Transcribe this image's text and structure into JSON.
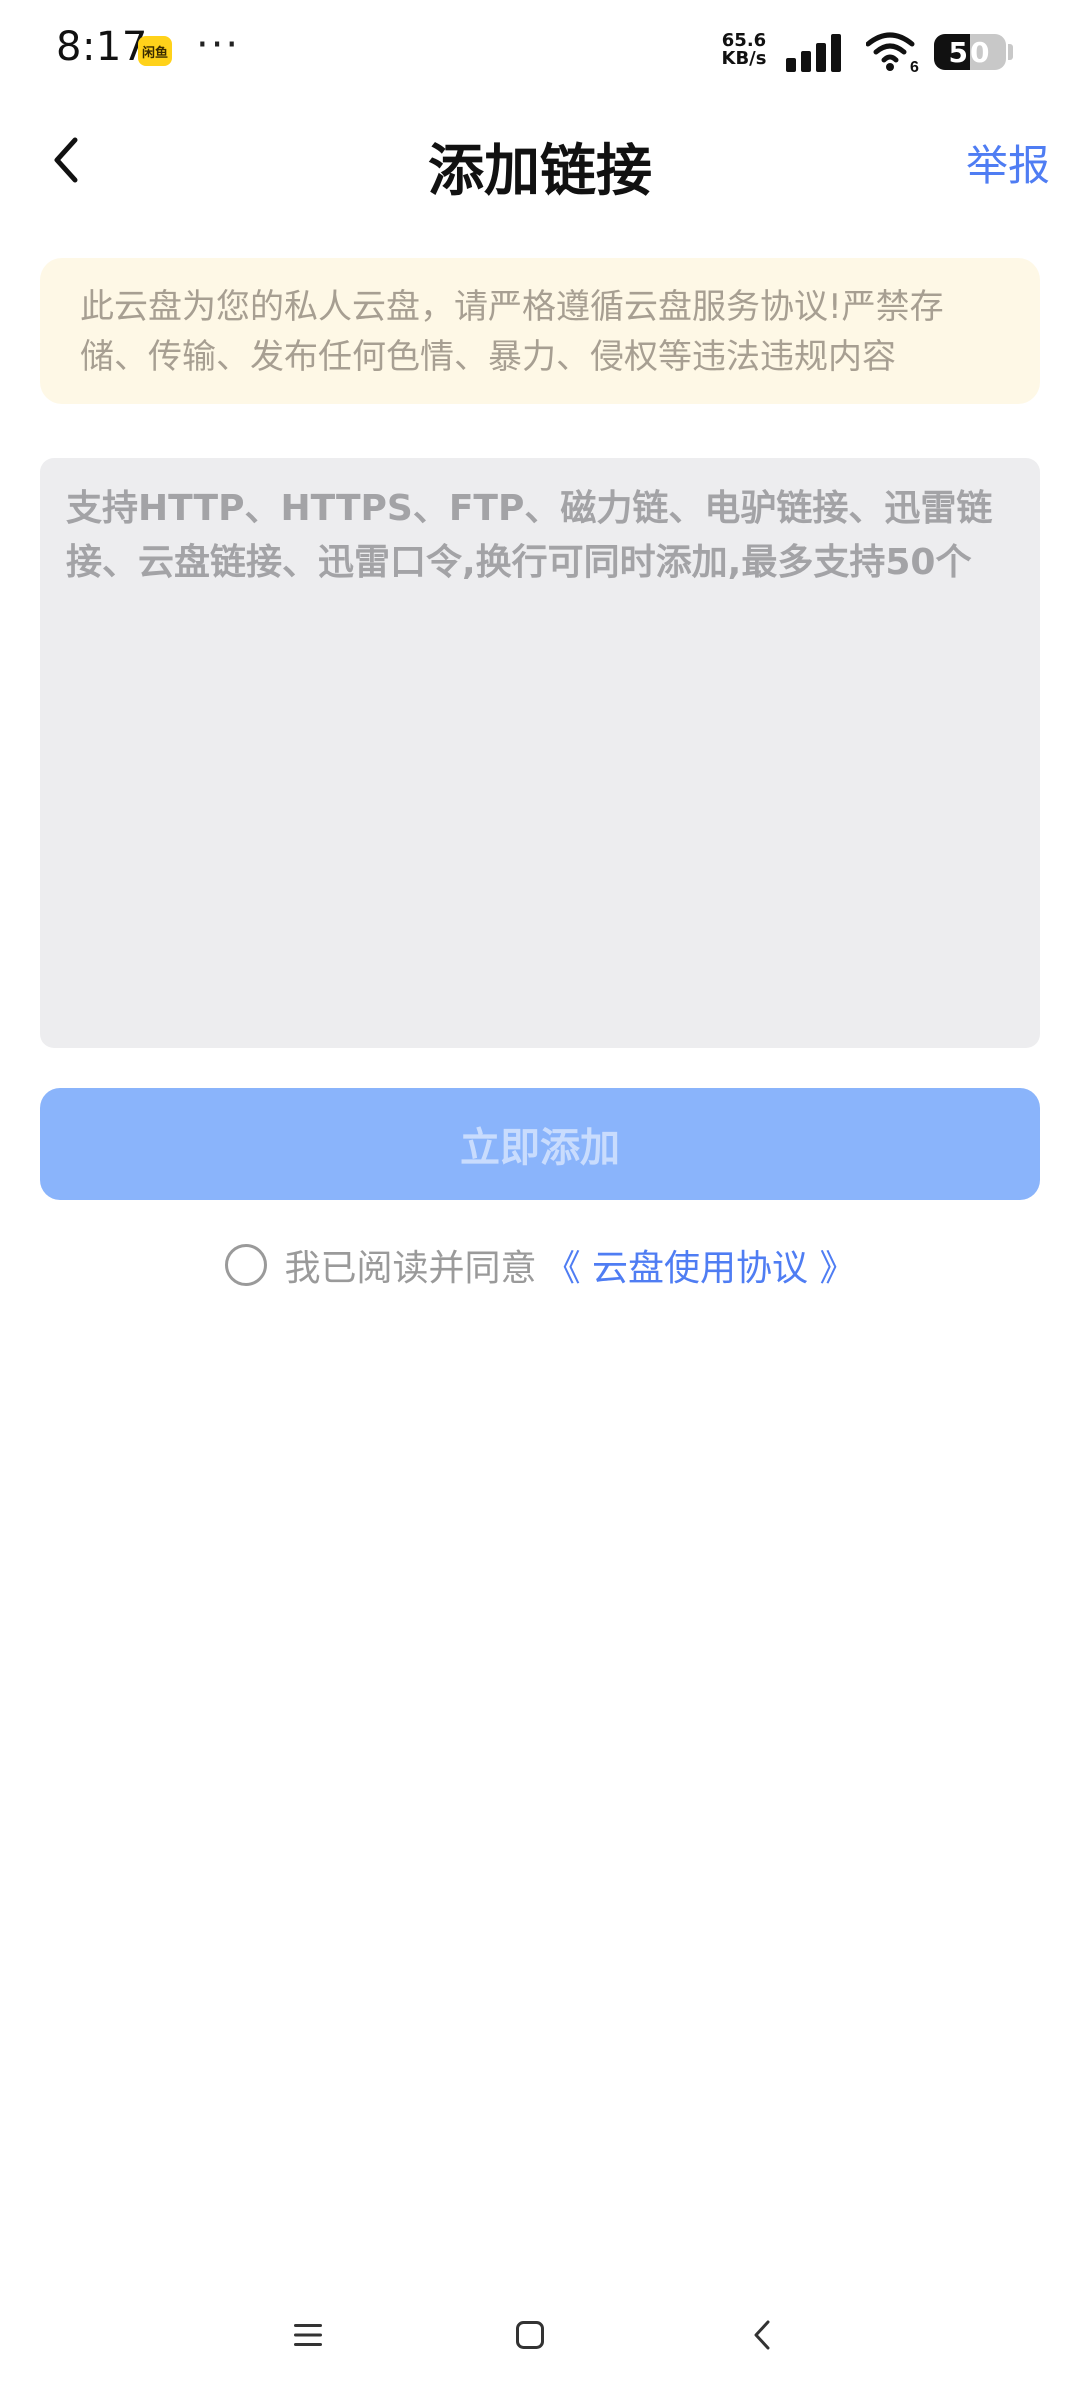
{
  "status_bar": {
    "time": "8:17",
    "app_badge": "闲鱼",
    "more": "···",
    "net_speed_value": "65.6",
    "net_speed_unit": "KB/s",
    "wifi_badge": "6",
    "battery_percent": 50,
    "battery_label": "50",
    "icons": [
      "signal-icon",
      "wifi-icon",
      "battery-icon"
    ]
  },
  "header": {
    "back_icon": "chevron-left-icon",
    "title": "添加链接",
    "report_label": "举报"
  },
  "notice": {
    "text": "此云盘为您的私人云盘，请严格遵循云盘服务协议!严禁存储、传输、发布任何色情、暴力、侵权等违法违规内容"
  },
  "link_input": {
    "value": "",
    "placeholder": "支持HTTP、HTTPS、FTP、磁力链、电驴链接、迅雷链接、云盘链接、迅雷口令,换行可同时添加,最多支持50个"
  },
  "submit": {
    "label": "立即添加"
  },
  "agreement": {
    "checked": false,
    "text": "我已阅读并同意",
    "link_label": "《 云盘使用协议 》"
  },
  "nav_bar": {
    "icons": [
      "menu-icon",
      "home-icon",
      "back-icon"
    ]
  },
  "colors": {
    "accent": "#4f7df3",
    "button_disabled": "#8ab4fb",
    "notice_bg": "#fef8e6",
    "input_bg": "#ededef"
  }
}
